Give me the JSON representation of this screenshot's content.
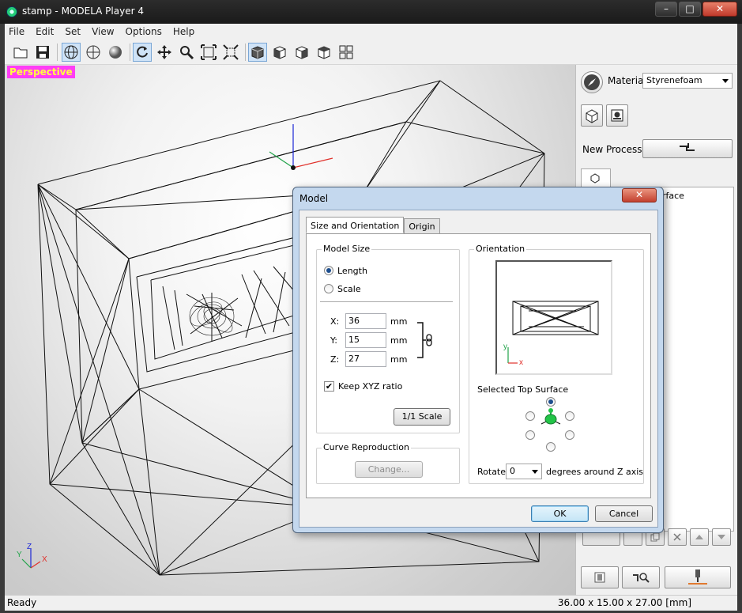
{
  "window": {
    "title": "stamp - MODELA Player 4",
    "min": "–",
    "max": "□",
    "close": "✕"
  },
  "menu": [
    "File",
    "Edit",
    "Set",
    "View",
    "Options",
    "Help"
  ],
  "viewport": {
    "label": "Perspective",
    "axes": {
      "x": "X",
      "y": "Y",
      "z": "Z"
    }
  },
  "right_panel": {
    "material_label": "Material",
    "material_value": "Styrenefoam",
    "new_process_label": "New Process",
    "process_item_fragment": "rface"
  },
  "status": {
    "left": "Ready",
    "right": "36.00 x 15.00 x 27.00 [mm]"
  },
  "dialog": {
    "title": "Model",
    "tabs": [
      "Size and Orientation",
      "Origin"
    ],
    "model_size": {
      "label": "Model Size",
      "length": "Length",
      "scale": "Scale",
      "x_label": "X:",
      "x_value": "36",
      "y_label": "Y:",
      "y_value": "15",
      "z_label": "Z:",
      "z_value": "27",
      "unit": "mm",
      "keep_ratio": "Keep XYZ ratio",
      "scale_button": "1/1 Scale"
    },
    "curve": {
      "label": "Curve Reproduction",
      "change_button": "Change..."
    },
    "orientation": {
      "label": "Orientation",
      "selected_top": "Selected Top Surface",
      "rotate_label": "Rotate",
      "rotate_value": "0",
      "rotate_suffix": "degrees around Z axis",
      "preview_axes": {
        "x": "x",
        "y": "y"
      }
    },
    "ok": "OK",
    "cancel": "Cancel"
  }
}
